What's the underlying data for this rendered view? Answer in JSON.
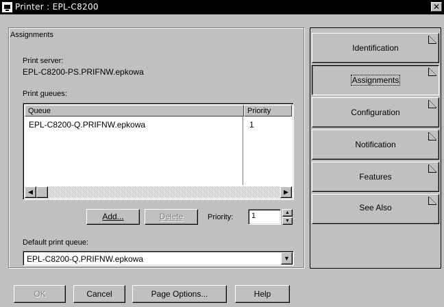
{
  "window": {
    "title": "Printer : EPL-C8200",
    "close_glyph": "✕"
  },
  "assignments": {
    "caption": "Assignments",
    "print_server_label": "Print server:",
    "print_server_value": "EPL-C8200-PS.PRIFNW.epkowa",
    "print_queues_label": "Print queues:",
    "columns": [
      "Queue",
      "Priority"
    ],
    "rows": [
      {
        "queue": "EPL-C8200-Q.PRIFNW.epkowa",
        "priority": "1"
      }
    ],
    "add_label": "Add...",
    "delete_label": "Delete",
    "priority_label": "Priority:",
    "priority_value": "1",
    "default_queue_label": "Default print queue:",
    "default_queue_value": "EPL-C8200-Q.PRIFNW.epkowa"
  },
  "tabs": [
    {
      "label": "Identification",
      "active": false
    },
    {
      "label": "Assignments",
      "active": true
    },
    {
      "label": "Configuration",
      "active": false
    },
    {
      "label": "Notification",
      "active": false
    },
    {
      "label": "Features",
      "active": false
    },
    {
      "label": "See Also",
      "active": false
    }
  ],
  "footer": {
    "ok_label": "OK",
    "cancel_label": "Cancel",
    "page_options_label": "Page Options...",
    "help_label": "Help"
  }
}
